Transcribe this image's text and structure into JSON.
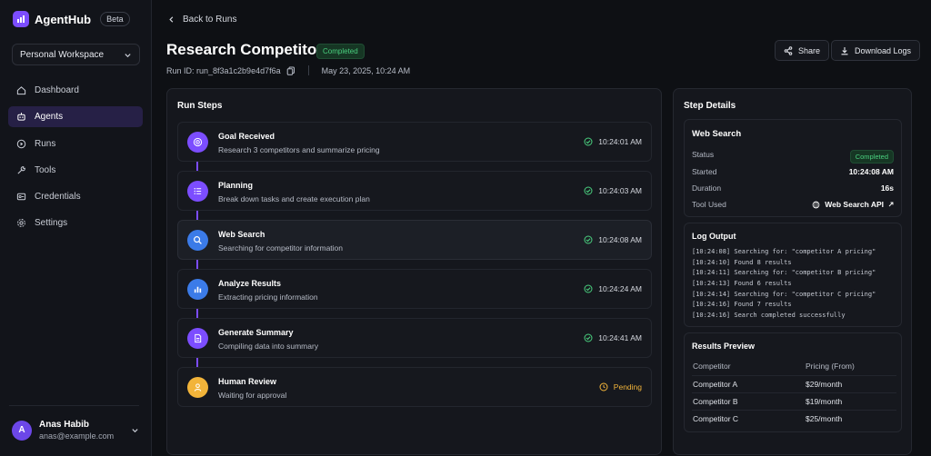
{
  "app": {
    "name": "AgentHub",
    "badge": "Beta"
  },
  "workspace": {
    "label": "Personal Workspace"
  },
  "nav": [
    {
      "label": "Dashboard",
      "icon": "home-icon",
      "active": false
    },
    {
      "label": "Agents",
      "icon": "bot-icon",
      "active": true
    },
    {
      "label": "Runs",
      "icon": "play-icon",
      "active": false
    },
    {
      "label": "Tools",
      "icon": "tools-icon",
      "active": false
    },
    {
      "label": "Credentials",
      "icon": "key-icon",
      "active": false
    },
    {
      "label": "Settings",
      "icon": "gear-icon",
      "active": false
    }
  ],
  "user": {
    "initial": "A",
    "name": "Anas Habib",
    "email": "anas@example.com"
  },
  "header": {
    "back_label": "Back to Runs",
    "title": "Research Competitors",
    "status": "Completed",
    "run_id": "Run ID: run_8f3a1c2b9e4d7f6a",
    "date": "May 23, 2025, 10:24 AM",
    "share_label": "Share",
    "download_label": "Download Logs"
  },
  "run_steps": {
    "title": "Run Steps",
    "steps": [
      {
        "title": "Goal Received",
        "desc": "Research 3 competitors and summarize pricing",
        "time": "10:24:01 AM",
        "status": "done",
        "color": "#7c4dff",
        "icon": "target-icon"
      },
      {
        "title": "Planning",
        "desc": "Break down tasks and create execution plan",
        "time": "10:24:03 AM",
        "status": "done",
        "color": "#7c4dff",
        "icon": "list-icon"
      },
      {
        "title": "Web Search",
        "desc": "Searching for competitor information",
        "time": "10:24:08 AM",
        "status": "done",
        "color": "#3b7be8",
        "icon": "search-icon"
      },
      {
        "title": "Analyze Results",
        "desc": "Extracting pricing information",
        "time": "10:24:24 AM",
        "status": "done",
        "color": "#3b7be8",
        "icon": "chart-icon"
      },
      {
        "title": "Generate Summary",
        "desc": "Compiling data into summary",
        "time": "10:24:41 AM",
        "status": "done",
        "color": "#7c4dff",
        "icon": "document-icon"
      },
      {
        "title": "Human Review",
        "desc": "Waiting for approval",
        "time": "Pending",
        "status": "pending",
        "color": "#f2b43a",
        "icon": "user-icon"
      }
    ]
  },
  "step_details": {
    "title": "Step Details",
    "step_name": "Web Search",
    "fields": [
      {
        "label": "Status",
        "value": "Completed"
      },
      {
        "label": "Started",
        "value": "10:24:08 AM"
      },
      {
        "label": "Duration",
        "value": "16s"
      },
      {
        "label": "Tool Used",
        "value": "Web Search API"
      }
    ],
    "log_title": "Log Output",
    "log_lines": [
      "[10:24:08] Searching for: \"competitor A pricing\"",
      "[10:24:10] Found 8 results",
      "[10:24:11] Searching for: \"competitor B pricing\"",
      "[10:24:13] Found 6 results",
      "[10:24:14] Searching for: \"competitor C pricing\"",
      "[10:24:16] Found 7 results",
      "[10:24:16] Search completed successfully"
    ],
    "results_title": "Results Preview",
    "results_headers": [
      "Competitor",
      "Pricing (From)"
    ],
    "results_rows": [
      [
        "Competitor A",
        "$29/month"
      ],
      [
        "Competitor B",
        "$19/month"
      ],
      [
        "Competitor C",
        "$25/month"
      ]
    ]
  }
}
